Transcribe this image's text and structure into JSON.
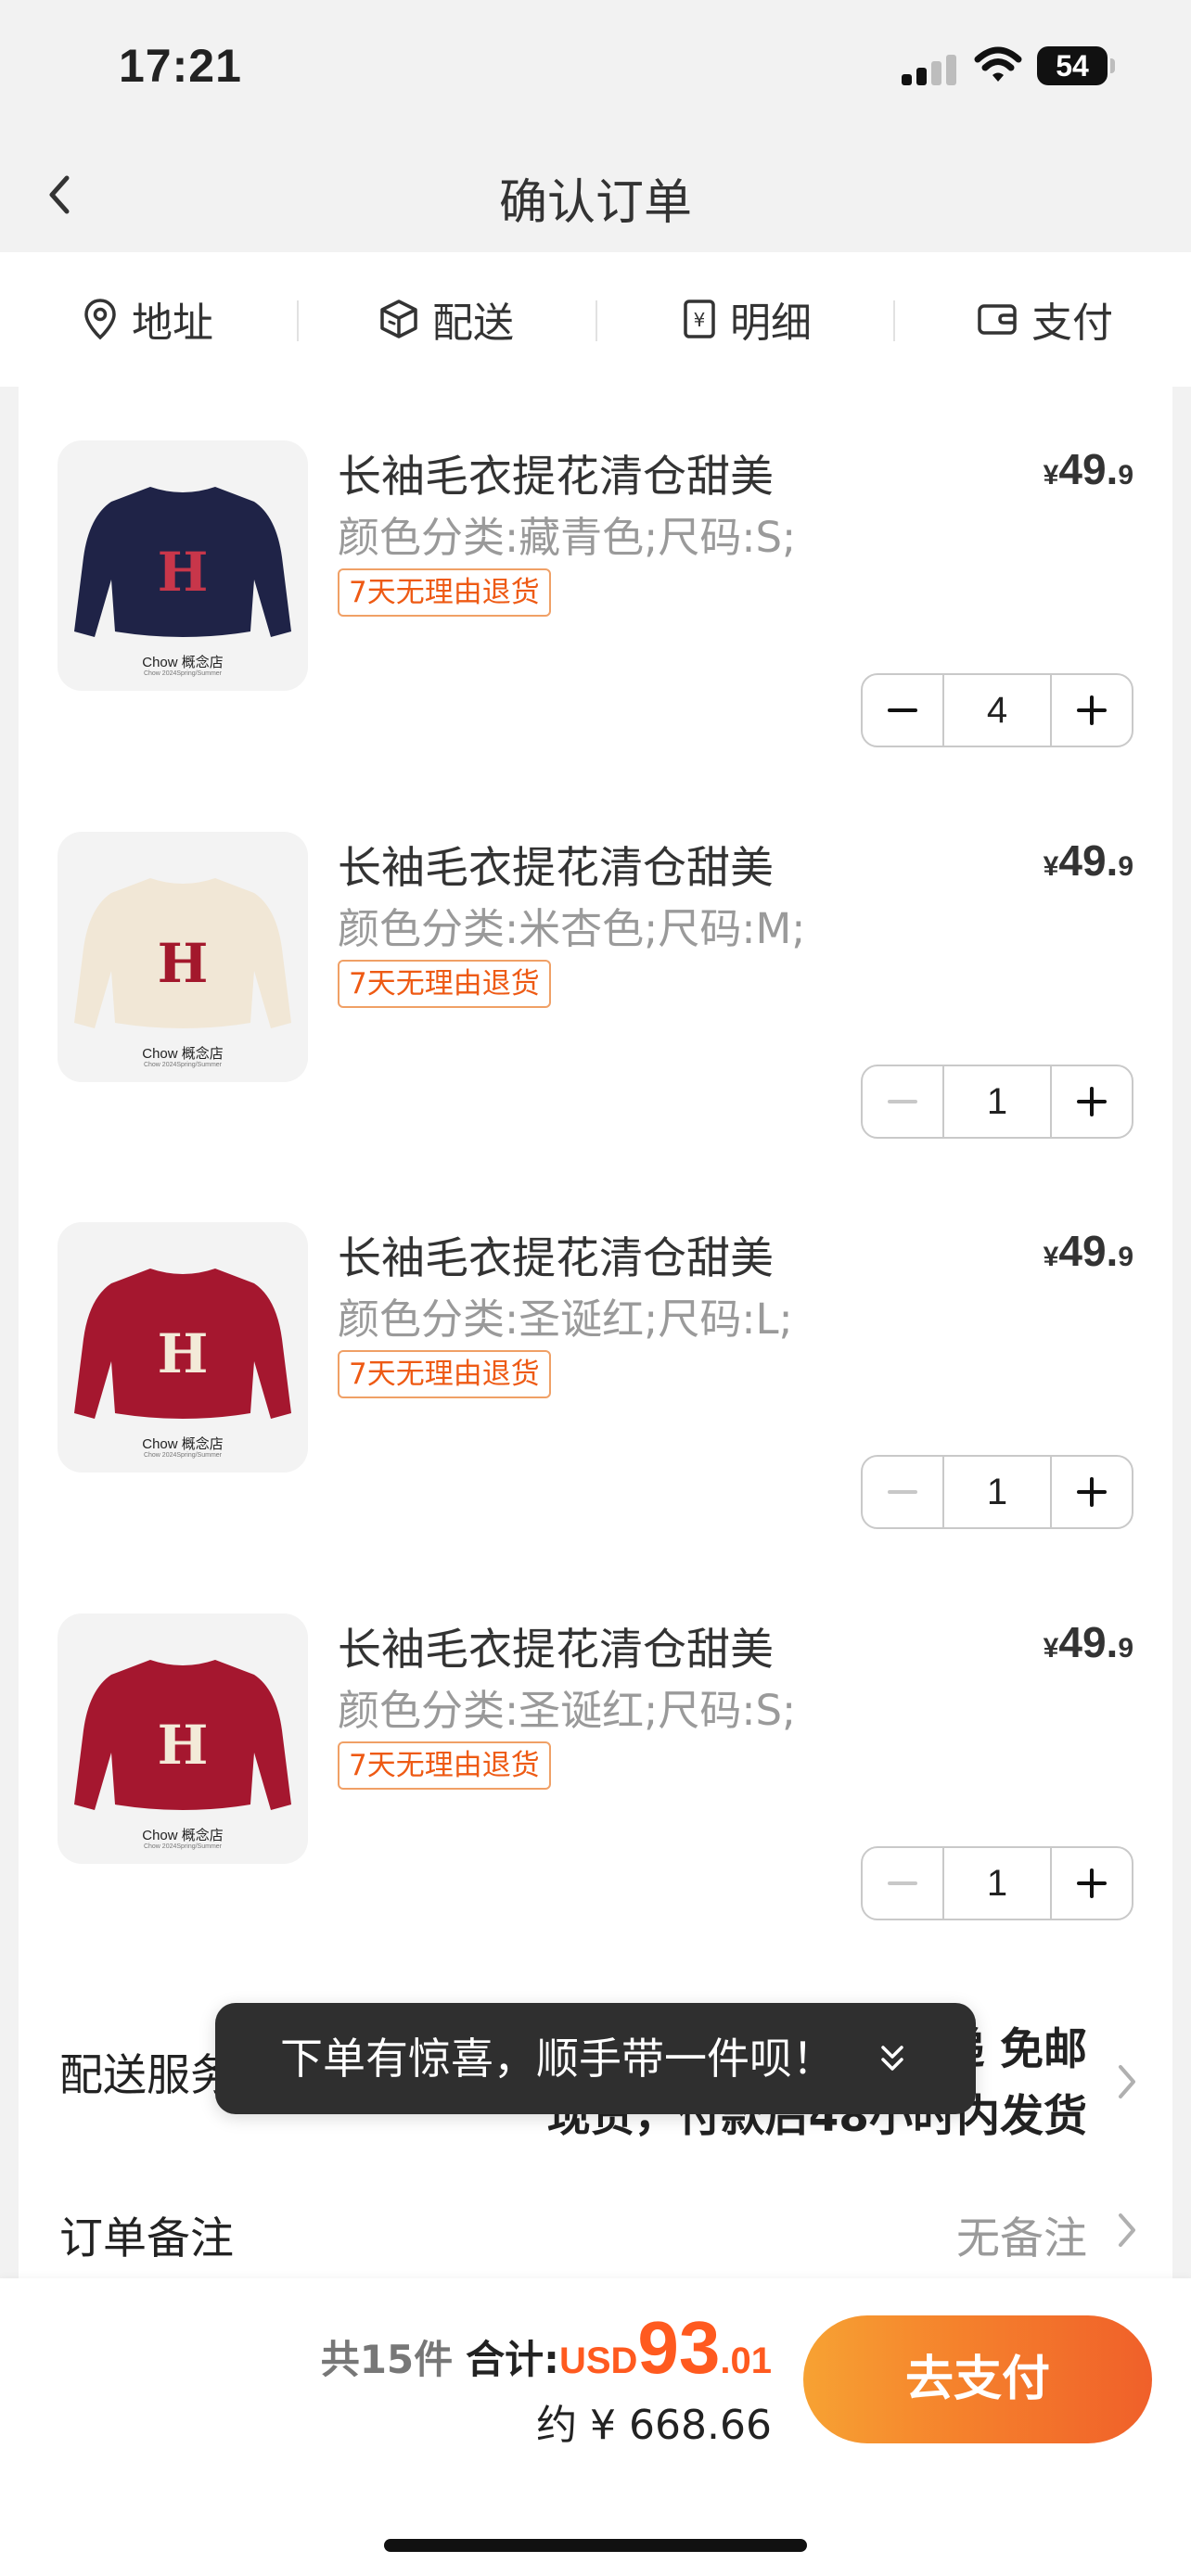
{
  "status_bar": {
    "time": "17:21",
    "battery": "54"
  },
  "nav": {
    "title": "确认订单"
  },
  "steps": [
    {
      "label": "地址",
      "icon": "location-pin-icon"
    },
    {
      "label": "配送",
      "icon": "package-icon"
    },
    {
      "label": "明细",
      "icon": "receipt-icon"
    },
    {
      "label": "支付",
      "icon": "wallet-icon"
    }
  ],
  "products": [
    {
      "title": "长袖毛衣提花清仓甜美",
      "variant": "颜色分类:藏青色;尺码:S;",
      "tag": "7天无理由退货",
      "price_currency": "¥",
      "price_int": "49.",
      "price_dec": "9",
      "quantity": "4",
      "store": "Chow 概念店",
      "store_sub": "Chow 2024Spring/Summer",
      "sweater_color": "#1f2347",
      "letter_color": "#c8364a",
      "minus_enabled": true
    },
    {
      "title": "长袖毛衣提花清仓甜美",
      "variant": "颜色分类:米杏色;尺码:M;",
      "tag": "7天无理由退货",
      "price_currency": "¥",
      "price_int": "49.",
      "price_dec": "9",
      "quantity": "1",
      "store": "Chow 概念店",
      "store_sub": "Chow 2024Spring/Summer",
      "sweater_color": "#f1e7d6",
      "letter_color": "#a3182c",
      "minus_enabled": false
    },
    {
      "title": "长袖毛衣提花清仓甜美",
      "variant": "颜色分类:圣诞红;尺码:L;",
      "tag": "7天无理由退货",
      "price_currency": "¥",
      "price_int": "49.",
      "price_dec": "9",
      "quantity": "1",
      "store": "Chow 概念店",
      "store_sub": "Chow 2024Spring/Summer",
      "sweater_color": "#a5172f",
      "letter_color": "#f3ead8",
      "minus_enabled": false
    },
    {
      "title": "长袖毛衣提花清仓甜美",
      "variant": "颜色分类:圣诞红;尺码:S;",
      "tag": "7天无理由退货",
      "price_currency": "¥",
      "price_int": "49.",
      "price_dec": "9",
      "quantity": "1",
      "store": "Chow 概念店",
      "store_sub": "Chow 2024Spring/Summer",
      "sweater_color": "#a5172f",
      "letter_color": "#f3ead8",
      "minus_enabled": false
    }
  ],
  "delivery": {
    "label": "配送服务",
    "line1": "快递 免邮",
    "line2": "现货，付款后48小时内发货"
  },
  "remark": {
    "label": "订单备注",
    "value": "无备注"
  },
  "toast": {
    "text": "下单有惊喜，顺手带一件呗！"
  },
  "summary": {
    "count": "共15件",
    "label": "合计:",
    "currency": "USD",
    "int": "93",
    "dec": ".01",
    "approx": "约 ¥ 668.66"
  },
  "pay_button": {
    "label": "去支付"
  },
  "colors": {
    "accent": "#ff5a1f",
    "tag_border": "#f0a066"
  }
}
